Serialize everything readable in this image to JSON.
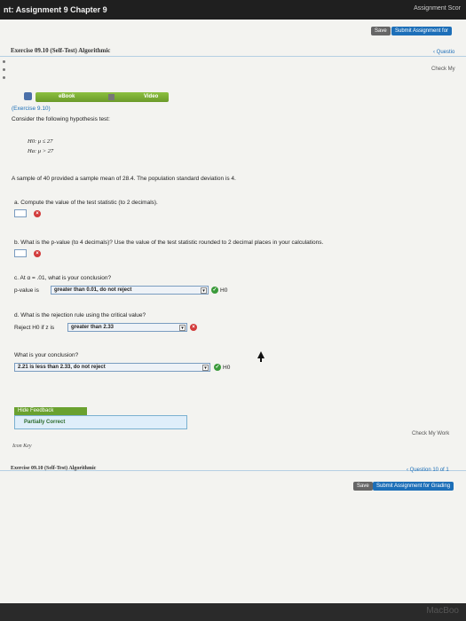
{
  "topbar": {
    "title": "nt: Assignment 9 Chapter 9",
    "right": "Assignment Scor"
  },
  "header": {
    "save_label": "Save",
    "submit_label": "Submit Assignment for"
  },
  "exercise": {
    "title_top": "Exercise 09.10 (Self-Test) Algorithmic",
    "question_link": "‹ Questio",
    "check_my_work_top": "Check My",
    "ebook_label": "eBook",
    "video_label": "Video",
    "exercise_link": "(Exercise 9.10)",
    "intro": "Consider the following hypothesis test:",
    "h0": "H0: μ ≤ 27",
    "ha": "Ha: μ > 27",
    "sample": "A sample of 40 provided a sample mean of 28.4. The population standard deviation is 4.",
    "qa": "a. Compute the value of the test statistic (to 2 decimals).",
    "qb": "b. What is the p-value (to 4 decimals)? Use the value of the test statistic rounded to 2 decimal places in your calculations.",
    "qc": "c. At α = .01, what is your conclusion?",
    "pvalue_prefix": "p-value is",
    "pvalue_select": "greater than 0.01, do not reject",
    "h0_label": "H0",
    "qd": "d. What is the rejection rule using the critical value?",
    "reject_prefix": "Reject H0 if z is",
    "reject_select": "greater than 2.33",
    "conclusion_q": "What is your conclusion?",
    "conclusion_select": "2.21 is less than 2.33, do not reject",
    "h0_label2": "H0",
    "feedback_label": "Hide Feedback",
    "feedback_text": "Partially Correct",
    "check_my_work": "Check My Work",
    "icon_key": "Icon Key",
    "title_bottom": "Exercise 09.10 (Self-Test) Algorithmic",
    "question_bottom": "‹ Question 10 of 1",
    "save_bottom": "Save",
    "submit_bottom": "Submit Assignment for Grading"
  },
  "os": {
    "brand": "MacBoo"
  },
  "colors": {
    "accent": "#1d6fb8",
    "green": "#6aa12f",
    "error": "#d23a3a",
    "success": "#3a9a3a"
  }
}
